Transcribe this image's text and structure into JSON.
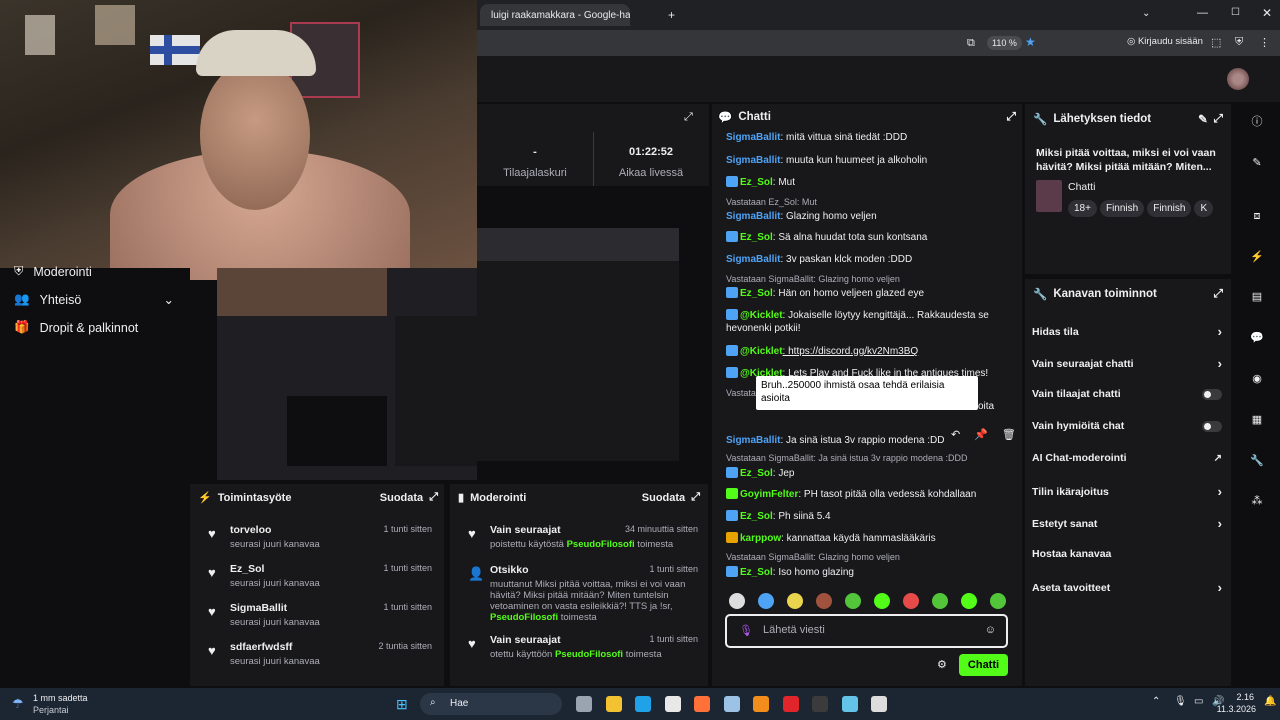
{
  "browser": {
    "tab_title": "luigi raakamakkara - Google-haku",
    "zoom": "110 %",
    "signin": "Kirjaudu sisään"
  },
  "left_nav": {
    "items": [
      {
        "label": "Moderointi"
      },
      {
        "label": "Yhteisö"
      },
      {
        "label": "Dropit & palkinnot"
      }
    ]
  },
  "stats": {
    "subs_value": "-",
    "subs_label": "Tilaajalaskuri",
    "live_value": "01:22:52",
    "live_label": "Aikaa livessä"
  },
  "chat": {
    "title": "Chatti",
    "messages": [
      {
        "user": "SigmaBallit",
        "text": ": mitä vittua sinä tiedät :DDD"
      },
      {
        "user": "SigmaBallit",
        "text": ": muuta kun huumeet ja alkoholin"
      },
      {
        "user": "Ez_Sol",
        "text": ": Mut"
      },
      {
        "reply": "Vastataan Ez_Sol: Mut"
      },
      {
        "user": "SigmaBallit",
        "text": ": Glazing homo veljen"
      },
      {
        "user": "Ez_Sol",
        "text": ": Sä alna huudat tota sun kontsana"
      },
      {
        "user": "SigmaBallit",
        "text": ": 3v paskan klck moden :DDD"
      },
      {
        "reply": "Vastataan SigmaBallit: Glazing homo veljen"
      },
      {
        "user": "Ez_Sol",
        "text": ": Hän on homo veljeen glazed eye"
      },
      {
        "user": "@Kicklet",
        "text": ": Jokaiselle löytyy kengittäjä... Rakkaudesta se hevonenki potkii!"
      },
      {
        "user": "@Kicklet",
        "text": ": https://discord.gg/kv2Nm3BQ"
      },
      {
        "user": "@Kicklet",
        "text": ": Lets Play and Fuck like in the antiques times!"
      },
      {
        "reply": "Vastataan Ez_Sol: Bruh..250000 ihmistä osaa tehd"
      },
      {
        "user": "SigmaBallit",
        "text": ": Ja sinä istua 3v rappio modena :DDD"
      },
      {
        "reply": "Vastataan SigmaBallit: Ja sinä istua 3v rappio modena :DDD"
      },
      {
        "user": "Ez_Sol",
        "text": ": Jep"
      },
      {
        "user": "GoyimFelter",
        "text": ": PH tasot pitää olla vedessä kohdallaan"
      },
      {
        "user": "Ez_Sol",
        "text": ": Ph siinä 5.4"
      },
      {
        "user": "karppow",
        "text": ": kannattaa käydä hammaslääkäris"
      },
      {
        "reply": "Vastataan SigmaBallit: Glazing homo veljen"
      },
      {
        "user": "Ez_Sol",
        "text": ": Iso homo glazing"
      }
    ],
    "tooltip": "Bruh..250000 ihmistä osaa tehdä erilaisia asioita",
    "partial_line": "oita",
    "input_placeholder": "Lähetä viesti",
    "send_label": "Chatti"
  },
  "stream_info": {
    "title": "Lähetyksen tiedot",
    "stream_title": "Miksi pitää voittaa, miksi ei voi vaan hävitä? Miksi pitää mitään? Miten...",
    "category": "Chatti",
    "tags": [
      "18+",
      "Finnish",
      "Finnish",
      "K"
    ]
  },
  "channel_actions": {
    "title": "Kanavan toiminnot",
    "items": [
      {
        "label": "Hidas tila",
        "control": "chevron"
      },
      {
        "label": "Vain seuraajat chatti",
        "control": "chevron"
      },
      {
        "label": "Vain tilaajat chatti",
        "control": "toggle"
      },
      {
        "label": "Vain hymiöitä chat",
        "control": "toggle"
      },
      {
        "label": "AI Chat-moderointi",
        "control": "external"
      },
      {
        "label": "Tilin ikärajoitus",
        "control": "chevron"
      },
      {
        "label": "Estetyt sanat",
        "control": "chevron"
      },
      {
        "label": "Hostaa kanavaa",
        "control": "none"
      },
      {
        "label": "Aseta tavoitteet",
        "control": "chevron"
      }
    ]
  },
  "activity": {
    "title": "Toimintasyöte",
    "filter": "Suodata",
    "items": [
      {
        "name": "torveloo",
        "desc": "seurasi juuri kanavaa",
        "time": "1 tunti sitten"
      },
      {
        "name": "Ez_Sol",
        "desc": "seurasi juuri kanavaa",
        "time": "1 tunti sitten"
      },
      {
        "name": "SigmaBallit",
        "desc": "seurasi juuri kanavaa",
        "time": "1 tunti sitten"
      },
      {
        "name": "sdfaerfwdsff",
        "desc": "seurasi juuri kanavaa",
        "time": "2 tuntia sitten"
      }
    ]
  },
  "moderation": {
    "title": "Moderointi",
    "filter": "Suodata",
    "items": [
      {
        "name": "Vain seuraajat",
        "desc_pre": "poistettu käytöstä ",
        "actor": "PseudoFilosofi",
        "desc_post": " toimesta",
        "time": "34 minuuttia sitten"
      },
      {
        "name": "Otsikko",
        "desc_pre": "muuttanut Miksi pitää voittaa, miksi ei voi vaan hävitä? Miksi pitää mitään? Miten tuntelsin vetoaminen on vasta esileikkiä?! TTS ja !sr, ",
        "actor": "PseudoFilosofi",
        "desc_post": " toimesta",
        "time": "1 tunti sitten"
      },
      {
        "name": "Vain seuraajat",
        "desc_pre": "otettu käyttöön ",
        "actor": "PseudoFilosofi",
        "desc_post": " toimesta",
        "time": "1 tunti sitten"
      }
    ]
  },
  "taskbar": {
    "weather": "1 mm sadetta",
    "weather_day": "Perjantai",
    "search": "Hae",
    "time": "2.16",
    "date": "11.3.2026"
  }
}
